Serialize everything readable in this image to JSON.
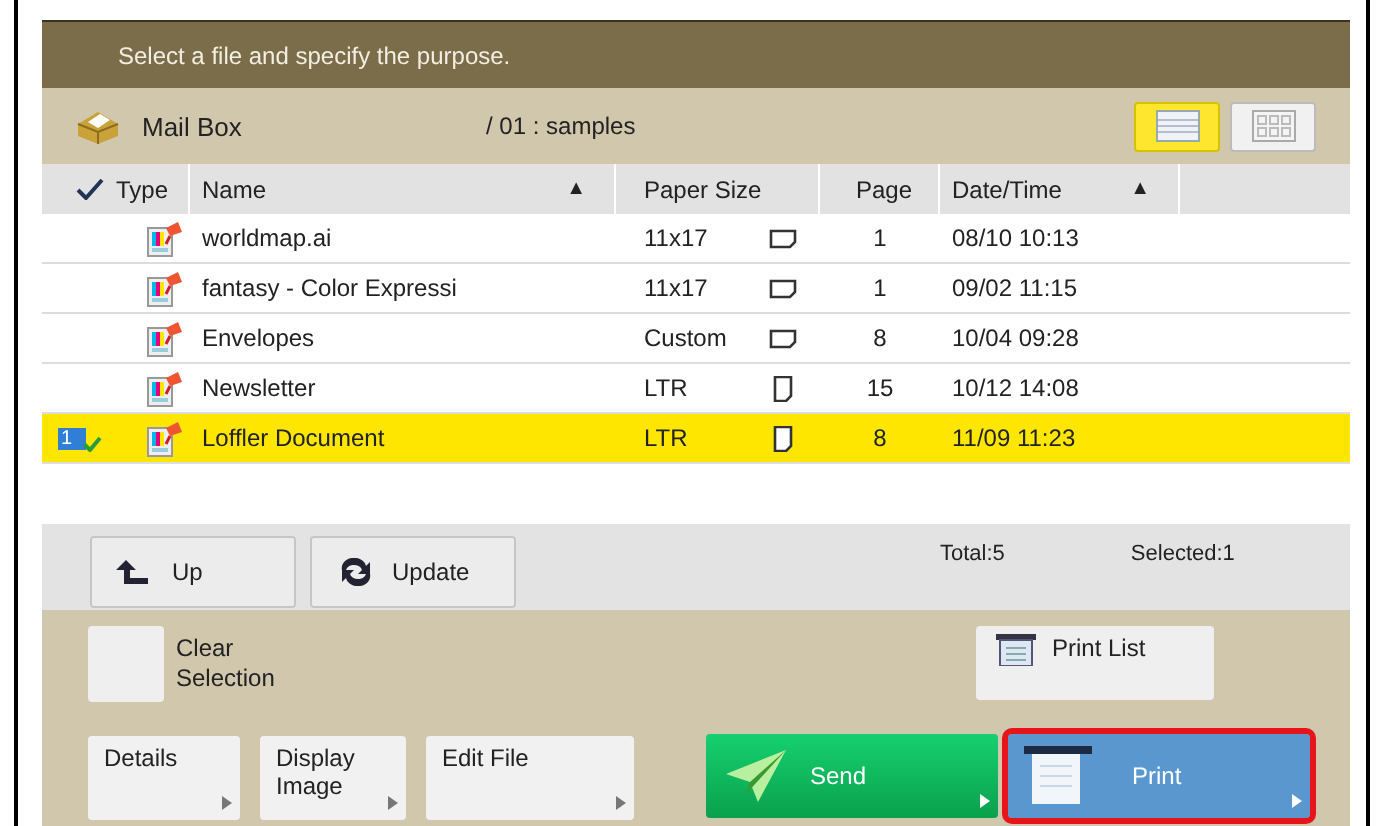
{
  "instruction": "Select a file and specify the purpose.",
  "location": {
    "box": "Mail Box",
    "path": "/ 01 : samples"
  },
  "view_buttons": [
    {
      "kind": "list",
      "selected": true
    },
    {
      "kind": "thumbnail",
      "selected": false
    }
  ],
  "table": {
    "columns": [
      {
        "kind": "type",
        "label": "Type"
      },
      {
        "kind": "name",
        "label": "Name",
        "sort_mark": "▲"
      },
      {
        "kind": "paper",
        "label": "Paper Size"
      },
      {
        "kind": "page",
        "label": "Page"
      },
      {
        "kind": "date",
        "label": "Date/Time",
        "sort_mark": "▲"
      }
    ],
    "rows": [
      {
        "name": "worldmap.ai",
        "paper_size": "11x17",
        "landscape": true,
        "page": "1",
        "date": "08/10  10:13",
        "selected": false
      },
      {
        "name": "fantasy - Color Expressi",
        "paper_size": "11x17",
        "landscape": true,
        "page": "1",
        "date": "09/02  11:15",
        "selected": false
      },
      {
        "name": "Envelopes",
        "paper_size": "Custom",
        "landscape": true,
        "page": "8",
        "date": "10/04  09:28",
        "selected": false
      },
      {
        "name": "Newsletter",
        "paper_size": "LTR",
        "landscape": false,
        "page": "15",
        "date": "10/12  14:08",
        "selected": false
      },
      {
        "name": "Loffler Document",
        "paper_size": "LTR",
        "landscape": false,
        "page": "8",
        "date": "11/09  11:23",
        "selected": true,
        "selection_number": "1"
      }
    ]
  },
  "nav_buttons": [
    {
      "kind": "up",
      "label": "Up"
    },
    {
      "kind": "update",
      "label": "Update"
    }
  ],
  "totals": {
    "total": "Total:5",
    "selected": "Selected:1"
  },
  "clear_selection": {
    "label": "Clear\nSelection"
  },
  "print_list": {
    "label": "Print List"
  },
  "actions": [
    {
      "kind": "plain",
      "label": "Details",
      "highlighted": false
    },
    {
      "kind": "plain",
      "label": "Display\nImage",
      "highlighted": false
    },
    {
      "kind": "plain",
      "label": "Edit File",
      "highlighted": false
    },
    {
      "kind": "send",
      "label": "Send",
      "highlighted": false
    },
    {
      "kind": "print",
      "label": "Print",
      "highlighted": true
    }
  ]
}
